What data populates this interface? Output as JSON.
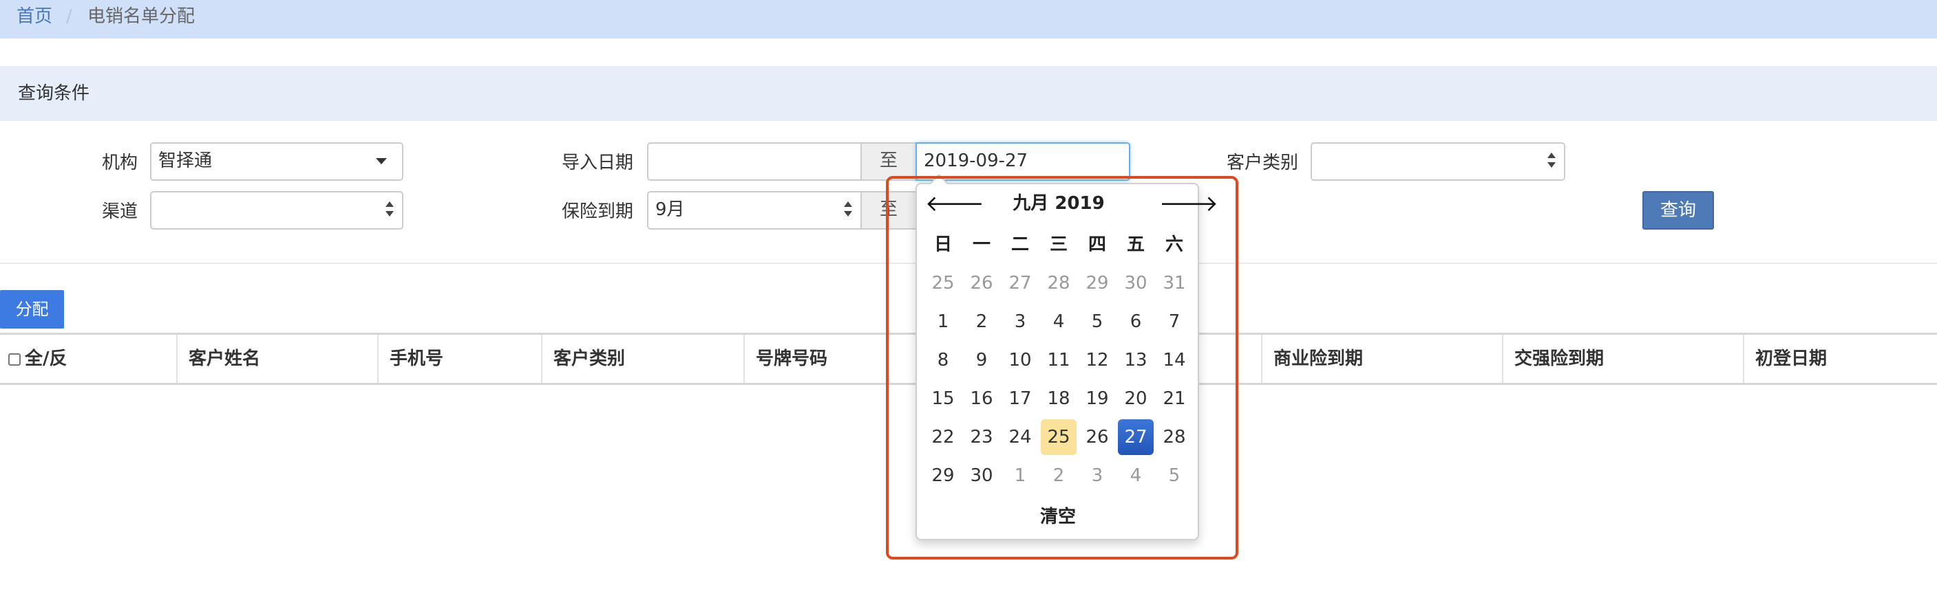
{
  "breadcrumb": {
    "home": "首页",
    "separator": "/",
    "current": "电销名单分配"
  },
  "query": {
    "title": "查询条件",
    "org_label": "机构",
    "org_value": "智择通",
    "channel_label": "渠道",
    "channel_value": "",
    "import_date_label": "导入日期",
    "import_date_from": "",
    "import_date_to_label": "至",
    "import_date_to": "2019-09-27",
    "insurance_expiry_label": "保险到期",
    "insurance_expiry_value": "9月",
    "insurance_expiry_to_label": "至",
    "customer_type_label": "客户类别",
    "customer_type_value": "",
    "query_button": "查询"
  },
  "assign_button": "分配",
  "table": {
    "columns": [
      "全/反",
      "客户姓名",
      "手机号",
      "客户类别",
      "号牌号码",
      "",
      "商业险到期",
      "交强险到期",
      "初登日期"
    ]
  },
  "datepicker": {
    "prev": "🡐",
    "next": "🡒",
    "title": "九月 2019",
    "weekdays": [
      "日",
      "一",
      "二",
      "三",
      "四",
      "五",
      "六"
    ],
    "weeks": [
      [
        "25",
        "26",
        "27",
        "28",
        "29",
        "30",
        "31"
      ],
      [
        "1",
        "2",
        "3",
        "4",
        "5",
        "6",
        "7"
      ],
      [
        "8",
        "9",
        "10",
        "11",
        "12",
        "13",
        "14"
      ],
      [
        "15",
        "16",
        "17",
        "18",
        "19",
        "20",
        "21"
      ],
      [
        "22",
        "23",
        "24",
        "25",
        "26",
        "27",
        "28"
      ],
      [
        "29",
        "30",
        "1",
        "2",
        "3",
        "4",
        "5"
      ]
    ],
    "today": "25",
    "selected": "27",
    "clear": "清空"
  },
  "colors": {
    "breadcrumb_bg": "#cfe0f8",
    "panel_header_bg": "#e6eff9",
    "query_button": "#4f7ab8",
    "assign_button": "#3d7be2",
    "today": "#fbe29b",
    "selected": "#2f63c6",
    "highlight": "#dc4a1f"
  }
}
